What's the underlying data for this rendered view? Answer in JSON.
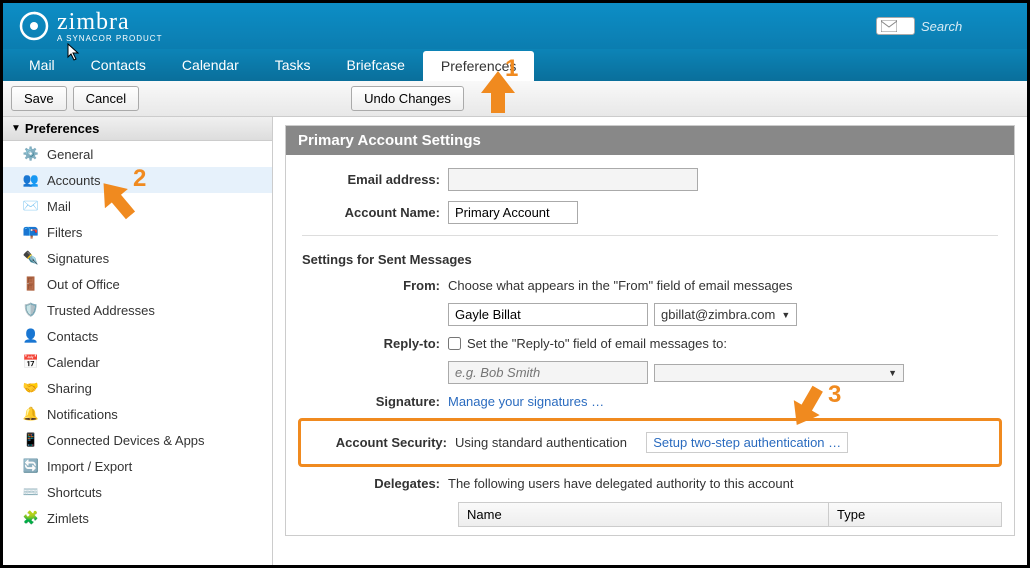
{
  "brand": {
    "name": "zimbra",
    "sub": "A SYNACOR PRODUCT"
  },
  "search": {
    "placeholder": "Search"
  },
  "nav": {
    "mail": "Mail",
    "contacts": "Contacts",
    "calendar": "Calendar",
    "tasks": "Tasks",
    "briefcase": "Briefcase",
    "preferences": "Preferences"
  },
  "toolbar": {
    "save": "Save",
    "cancel": "Cancel",
    "undo": "Undo Changes"
  },
  "sidebar": {
    "title": "Preferences",
    "items": [
      {
        "label": "General"
      },
      {
        "label": "Accounts"
      },
      {
        "label": "Mail"
      },
      {
        "label": "Filters"
      },
      {
        "label": "Signatures"
      },
      {
        "label": "Out of Office"
      },
      {
        "label": "Trusted Addresses"
      },
      {
        "label": "Contacts"
      },
      {
        "label": "Calendar"
      },
      {
        "label": "Sharing"
      },
      {
        "label": "Notifications"
      },
      {
        "label": "Connected Devices & Apps"
      },
      {
        "label": "Import / Export"
      },
      {
        "label": "Shortcuts"
      },
      {
        "label": "Zimlets"
      }
    ]
  },
  "panel": {
    "title": "Primary Account Settings",
    "email_label": "Email address:",
    "email_value": "",
    "acct_label": "Account Name:",
    "acct_value": "Primary Account",
    "sent_head": "Settings for Sent Messages",
    "from_label": "From:",
    "from_help": "Choose what appears in the \"From\" field of email messages",
    "from_name": "Gayle Billat",
    "from_addr": "gbillat@zimbra.com",
    "reply_label": "Reply-to:",
    "reply_check": "Set the \"Reply-to\" field of email messages to:",
    "reply_name_ph": "e.g. Bob Smith",
    "sig_label": "Signature:",
    "sig_link": "Manage your signatures …",
    "sec_label": "Account Security:",
    "sec_status": "Using standard authentication",
    "sec_link": "Setup two-step authentication …",
    "deleg_label": "Delegates:",
    "deleg_help": "The following users have delegated authority to this account",
    "deleg_col1": "Name",
    "deleg_col2": "Type"
  },
  "annot": {
    "n1": "1",
    "n2": "2",
    "n3": "3"
  }
}
